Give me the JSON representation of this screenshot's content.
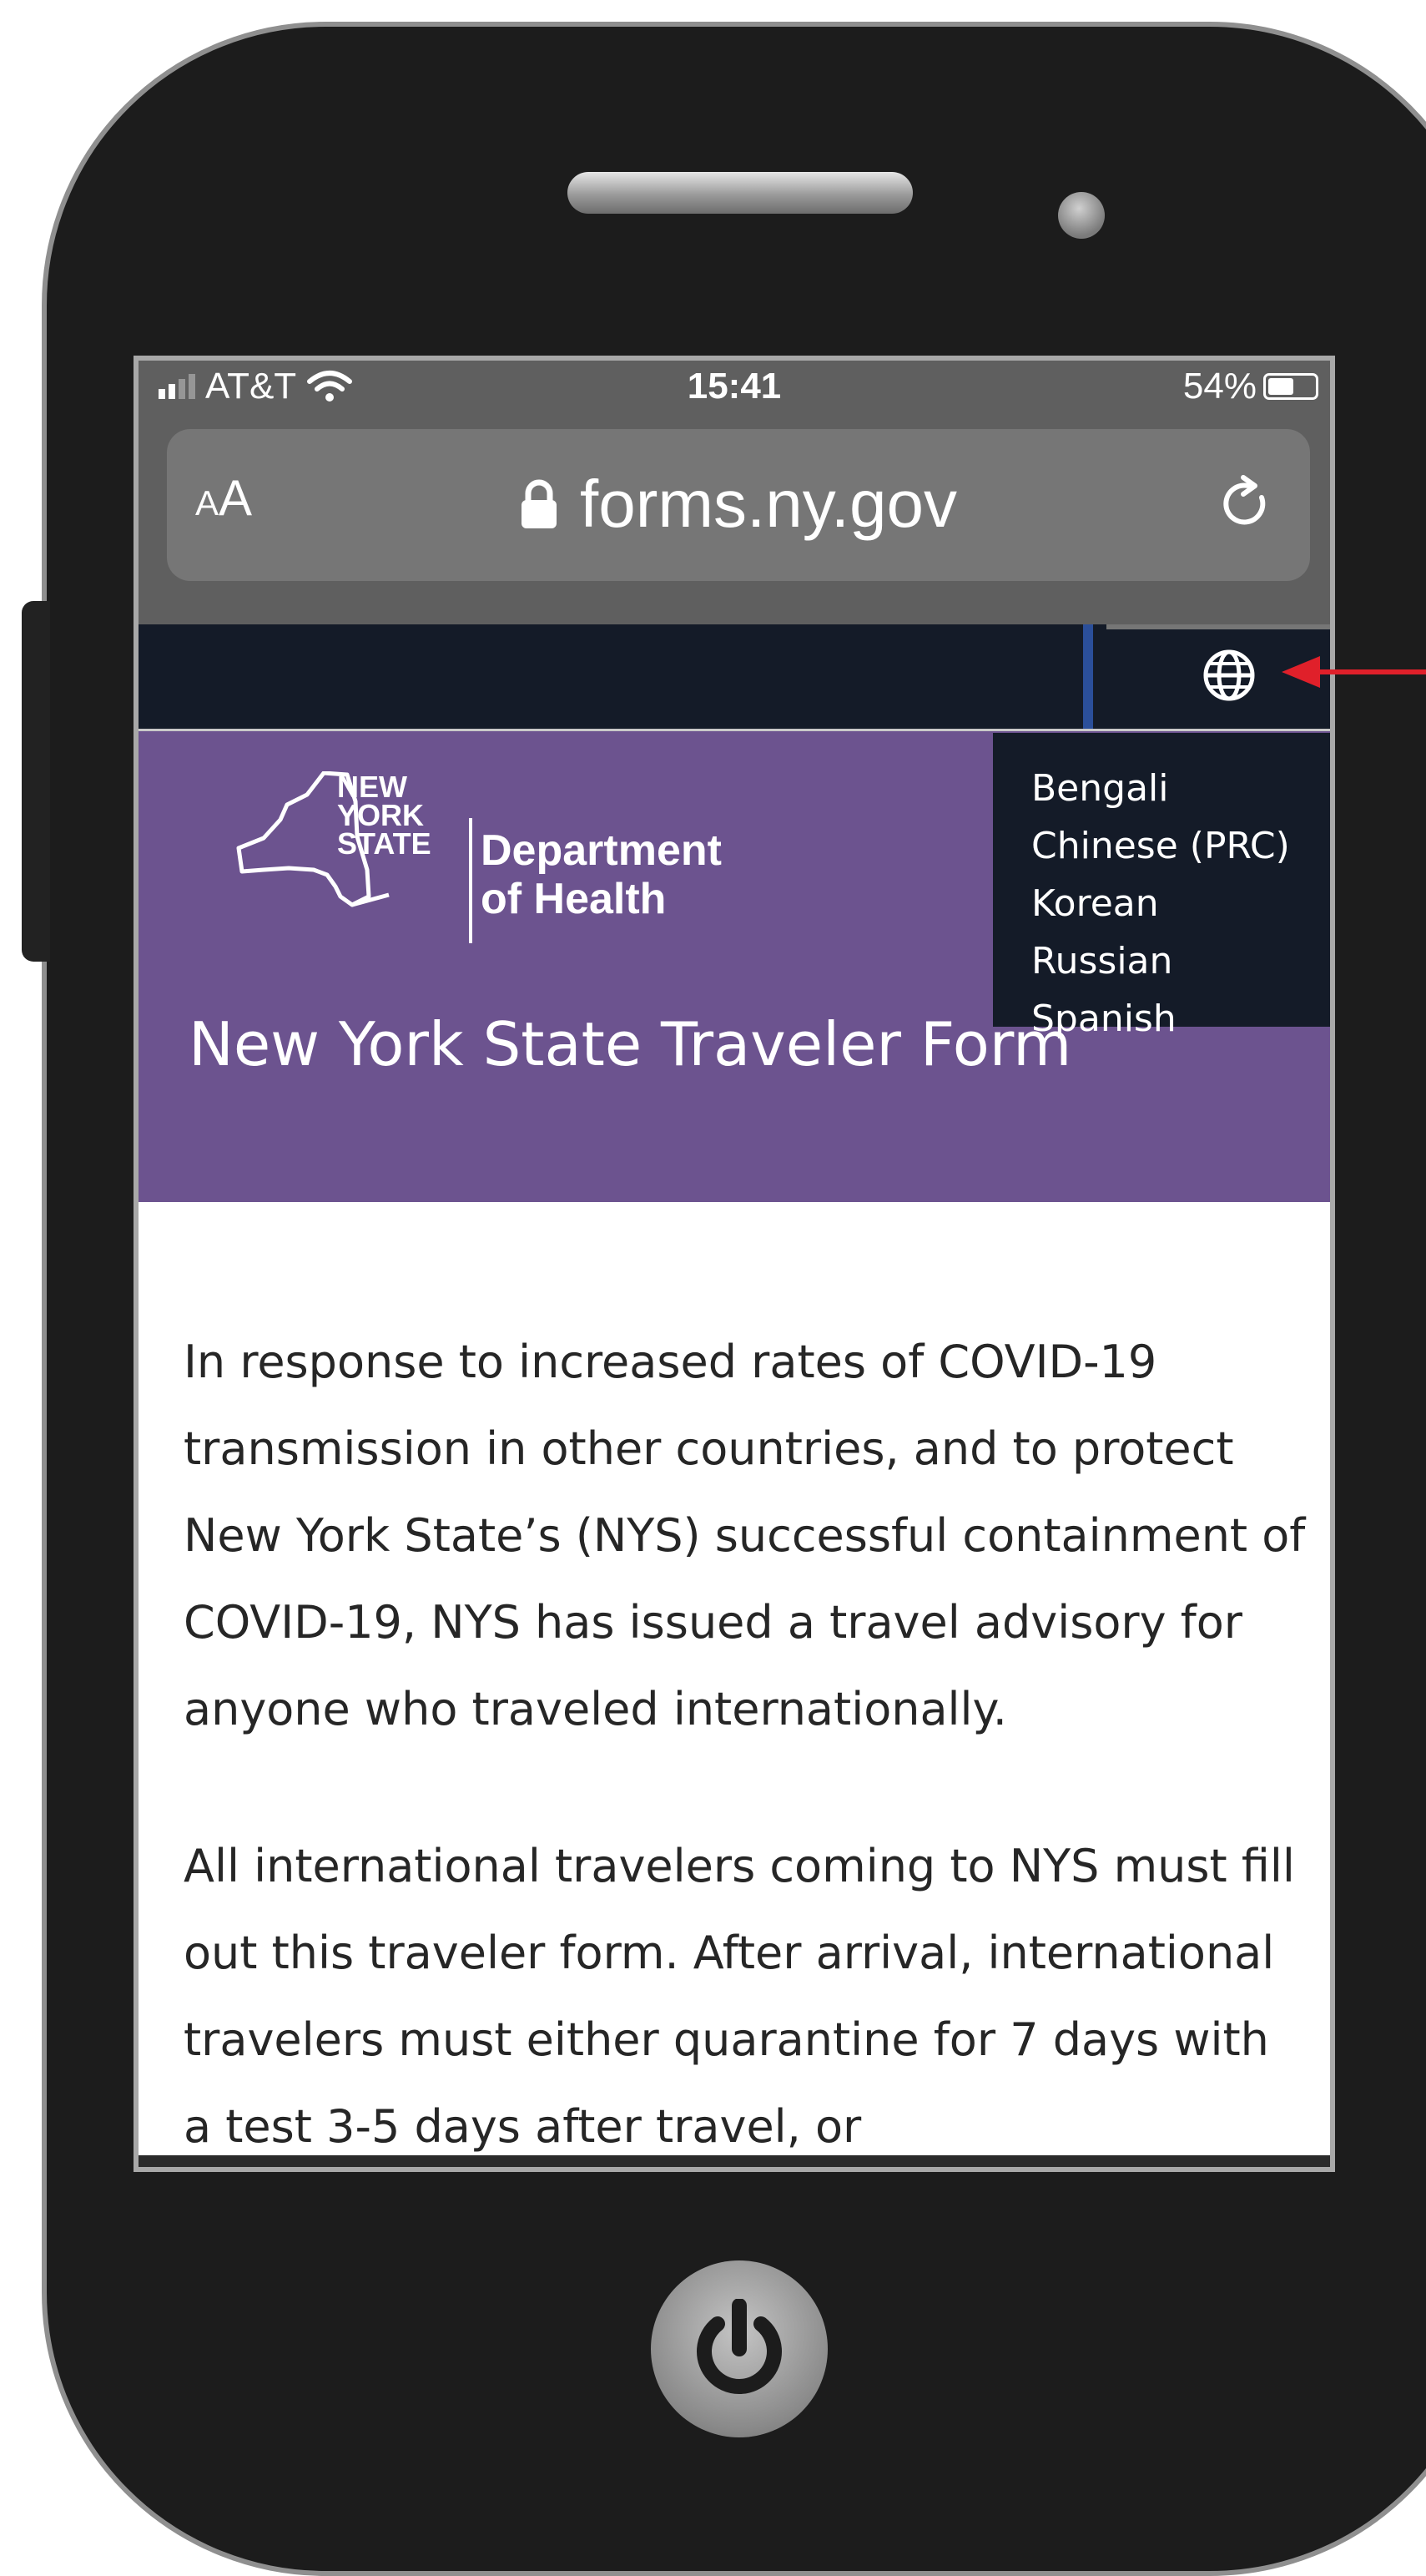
{
  "status_bar": {
    "carrier": "AT&T",
    "time": "15:41",
    "battery": "54%"
  },
  "browser": {
    "text_size_small": "A",
    "text_size_large": "A",
    "url": "forms.ny.gov"
  },
  "site": {
    "logo_state_line1": "NEW",
    "logo_state_line2": "YORK",
    "logo_state_line3": "STATE",
    "logo_dept_line1": "Department",
    "logo_dept_line2": "of Health",
    "page_title": "New York State Traveler Form"
  },
  "language_menu": {
    "items": [
      "Bengali",
      "Chinese (PRC)",
      "Korean",
      "Russian",
      "Spanish"
    ]
  },
  "content": {
    "paragraph1": "In response to increased rates of COVID-19 transmission in other countries, and to protect New York State’s (NYS) successful containment of COVID-19, NYS has issued a travel advisory for anyone who traveled internationally.",
    "paragraph2": "All international travelers coming to NYS must fill out this traveler form.  After arrival, international travelers must either quarantine for 7 days with a test 3-5 days after travel, or"
  },
  "colors": {
    "header_purple": "#6c538f",
    "nav_dark": "#141b28",
    "arrow_red": "#e0202a"
  }
}
